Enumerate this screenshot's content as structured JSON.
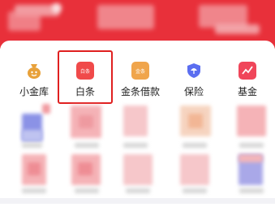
{
  "menu": {
    "items": [
      {
        "label": "小金库",
        "icon": "money-bag-icon",
        "color": "#e8a13a"
      },
      {
        "label": "白条",
        "icon": "baitiao-card-icon",
        "color": "#f04a4a",
        "badge": "白条"
      },
      {
        "label": "金条借款",
        "icon": "jintiao-card-icon",
        "color": "#f0a54c",
        "badge": "金条"
      },
      {
        "label": "保险",
        "icon": "shield-icon",
        "color": "#5b6ef0"
      },
      {
        "label": "基金",
        "icon": "chart-icon",
        "color": "#f0465a"
      }
    ],
    "selected": "白条"
  },
  "colors": {
    "header": "#e8303a",
    "highlight": "#e02020"
  }
}
